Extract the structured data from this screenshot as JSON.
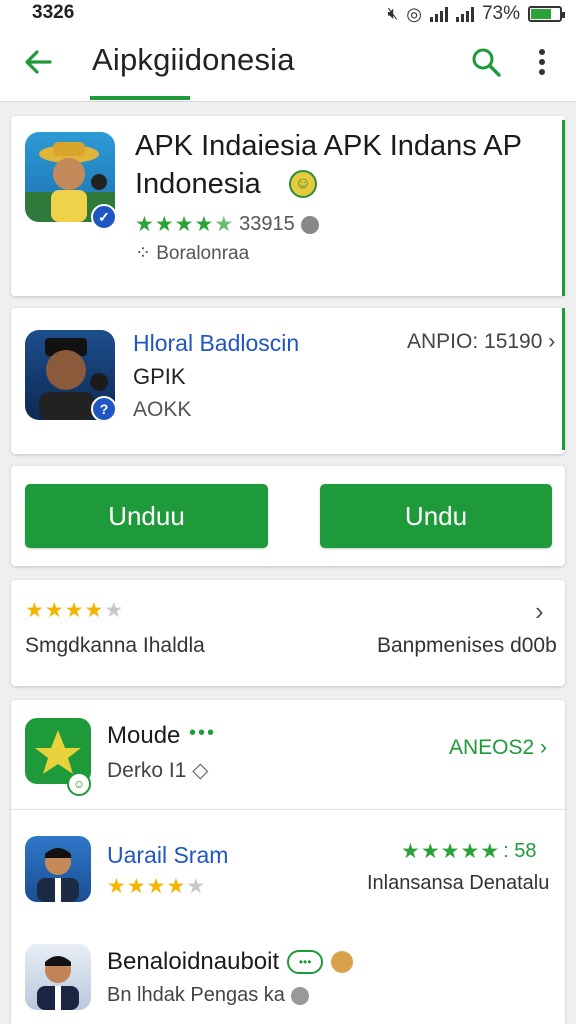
{
  "status": {
    "time": "3326",
    "battery": "73%",
    "battery_level": 0.73
  },
  "appbar": {
    "title": "Aipkgiidonesia"
  },
  "featured": {
    "title_line1": "APK Indaiesia APK Indans AP",
    "title_line2": "Indonesia",
    "rating_stars": 4.5,
    "rating_count": "33915",
    "subtitle": "⁘ Boralonraa"
  },
  "second_app": {
    "name": "Hloral Badloscin",
    "meta": "ANPIO: 15190",
    "line2": "GPIK",
    "line3": "AOKK"
  },
  "buttons": {
    "left_label": "Unduu",
    "right_label": "Undu"
  },
  "rating_card": {
    "stars": 4,
    "left_text": "Smgdkanna Ihaldla",
    "right_text": "Banpmenises d00b"
  },
  "list": [
    {
      "name": "Moude",
      "extra": "•••",
      "sub": "Derko I1",
      "right": "ANEOS2"
    },
    {
      "name": "Uarail Sram",
      "stars": 4,
      "right_stars": 5,
      "right_num": ": 58",
      "right_sub": "Inlansansa Denatalu"
    },
    {
      "name": "Benaloidnauboit",
      "sub": "Bn lhdak Pengas ka"
    }
  ],
  "colors": {
    "accent": "#1e9a3a",
    "link_blue": "#1f56c4",
    "star_green": "#2aa236",
    "star_yellow": "#f4b400"
  }
}
